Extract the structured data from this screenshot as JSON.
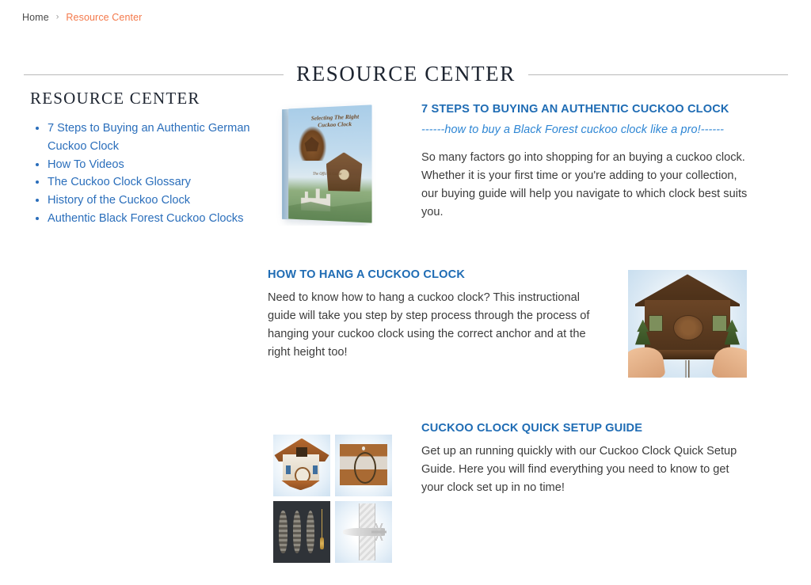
{
  "breadcrumb": {
    "home_label": "Home",
    "separator": "›",
    "current_label": "Resource Center"
  },
  "page": {
    "title": "RESOURCE CENTER"
  },
  "sidebar": {
    "title": "RESOURCE CENTER",
    "items": [
      {
        "label": "7 Steps to Buying an Authentic German Cuckoo Clock"
      },
      {
        "label": "How To Videos"
      },
      {
        "label": "The Cuckoo Clock Glossary"
      },
      {
        "label": "History of the Cuckoo Clock"
      },
      {
        "label": "Authentic Black Forest Cuckoo Clocks"
      }
    ]
  },
  "sections": [
    {
      "heading": "7 STEPS TO BUYING AN AUTHENTIC CUCKOO CLOCK",
      "subtitle": "------how to buy a Black Forest cuckoo clock like a pro!------",
      "body": "So many factors go into shopping for an buying a cuckoo clock. Whether it is your first time or you're adding to your collection, our buying guide will help you navigate to which clock best suits you.",
      "image_alt": "Selecting The Right Cuckoo Clock book cover",
      "book_title": "Selecting The Right Cuckoo Clock",
      "book_subtitle": "The Official Guide"
    },
    {
      "heading": "HOW TO HANG A CUCKOO CLOCK",
      "body": "Need to know how to hang a cuckoo clock? This instructional guide will take you step by step process through the process of hanging your cuckoo clock using the correct anchor and at the right height too!",
      "image_alt": "Hands holding a Black Forest chalet cuckoo clock"
    },
    {
      "heading": "CUCKOO CLOCK QUICK SETUP GUIDE",
      "body": "Get up an running quickly with our Cuckoo Clock Quick Setup Guide. Here you will find everything you need to know to get your clock set up in no time!",
      "image_alt": "Cuckoo clock quick setup guide collage"
    }
  ],
  "colors": {
    "breadcrumb_accent": "#f4794b",
    "heading_blue": "#1f6cb4",
    "link_blue": "#2a6ebb",
    "subtitle_blue": "#2e86d4",
    "body_text": "#3c3c3c",
    "title_navy": "#1d2430",
    "rule": "#b9b9b9"
  }
}
